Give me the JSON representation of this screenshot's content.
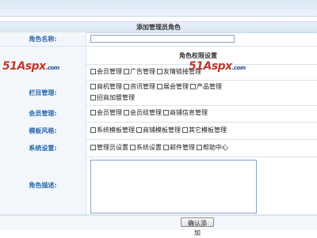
{
  "header": {
    "title": "添加管理员角色"
  },
  "form": {
    "role_name": {
      "label": "角色名称:",
      "value": ""
    },
    "permissions_title": "角色权限设置",
    "groups": [
      {
        "label": "",
        "lines": [
          [
            "会员管理",
            "广告管理",
            "友情链接管理"
          ]
        ]
      },
      {
        "label": "栏目管理:",
        "lines": [
          [
            "商机管理",
            "资讯管理",
            "展会管理",
            "产品管理"
          ],
          [
            "招商加盟管理"
          ]
        ]
      },
      {
        "label": "会员管理:",
        "lines": [
          [
            "会员管理",
            "会员组管理",
            "商铺信息管理"
          ]
        ]
      },
      {
        "label": "模板风格:",
        "lines": [
          [
            "系统模板管理",
            "商铺模板管理",
            "其它模板管理"
          ]
        ]
      },
      {
        "label": "系统设置:",
        "lines": [
          [
            "管理员设置",
            "系统设置",
            "邮件管理",
            "帮助中心"
          ]
        ]
      }
    ],
    "description": {
      "label": "角色描述:",
      "value": ""
    },
    "submit_label": "确认添加"
  },
  "watermark": {
    "brand": "51Aspx",
    "domain": ".com"
  }
}
